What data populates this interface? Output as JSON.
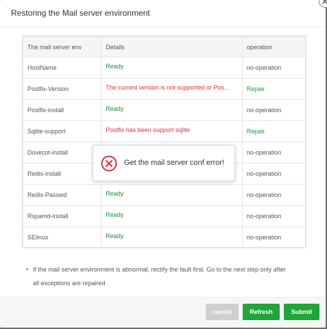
{
  "dialog": {
    "title": "Restoring the Mail server environment",
    "close_icon": "close-icon"
  },
  "table": {
    "headers": [
      "The mail server env",
      "Details",
      "operation"
    ],
    "rows": [
      {
        "name": "HostName",
        "detail": "Ready",
        "status": "ok",
        "operation": "no-operation"
      },
      {
        "name": "Postfix-Version",
        "detail": "The current version is not supported or Pos...",
        "status": "error",
        "operation": "Repair"
      },
      {
        "name": "Postfix-install",
        "detail": "Ready",
        "status": "ok",
        "operation": "no-operation"
      },
      {
        "name": "Sqlite-support",
        "detail": "Postfix has been support sqlite",
        "status": "error",
        "operation": "Repair"
      },
      {
        "name": "Dovecot-install",
        "detail": "",
        "status": "ok",
        "operation": "no-operation"
      },
      {
        "name": "Redis-install",
        "detail": "",
        "status": "ok",
        "operation": "no-operation"
      },
      {
        "name": "Redis-Passwd",
        "detail": "Ready",
        "status": "ok",
        "operation": "no-operation"
      },
      {
        "name": "Rspamd-install",
        "detail": "Ready",
        "status": "ok",
        "operation": "no-operation"
      },
      {
        "name": "SElinux",
        "detail": "Ready",
        "status": "ok",
        "operation": "no-operation"
      }
    ]
  },
  "note": "If the mail server environment is abnormal, rectify the fault first. Go to the next step only after all exceptions are repaired",
  "buttons": {
    "cancel": "cancel",
    "refresh": "Refresh",
    "submit": "Submit"
  },
  "toast": {
    "message": "Get the mail server conf error!",
    "icon": "error-circle-icon"
  },
  "colors": {
    "accent_green": "#20a53a",
    "error_red": "#e0303a"
  }
}
